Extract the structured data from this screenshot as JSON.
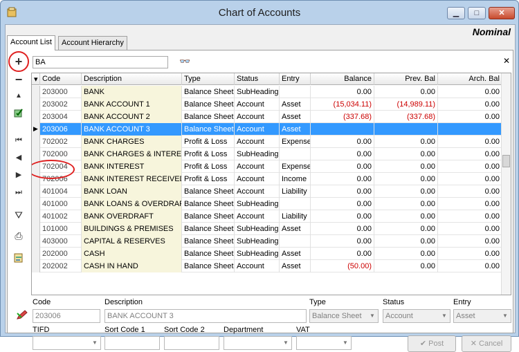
{
  "window": {
    "title": "Chart of Accounts",
    "module": "Nominal"
  },
  "tabs": [
    {
      "label": "Account List"
    },
    {
      "label": "Account Hierarchy"
    }
  ],
  "filter": {
    "value": "BA"
  },
  "columns": {
    "code": "Code",
    "description": "Description",
    "type": "Type",
    "status": "Status",
    "entry": "Entry",
    "balance": "Balance",
    "prev_bal": "Prev. Bal",
    "arch_bal": "Arch. Bal"
  },
  "rows": [
    {
      "code": "203000",
      "description": "BANK",
      "type": "Balance Sheet",
      "status": "SubHeading",
      "entry": "",
      "balance": "0.00",
      "prev_bal": "0.00",
      "arch_bal": "0.00"
    },
    {
      "code": "203002",
      "description": "BANK ACCOUNT 1",
      "type": "Balance Sheet",
      "status": "Account",
      "entry": "Asset",
      "balance": "(15,034.11)",
      "prev_bal": "(14,989.11)",
      "arch_bal": "0.00"
    },
    {
      "code": "203004",
      "description": "BANK ACCOUNT 2",
      "type": "Balance Sheet",
      "status": "Account",
      "entry": "Asset",
      "balance": "(337.68)",
      "prev_bal": "(337.68)",
      "arch_bal": "0.00"
    },
    {
      "code": "203006",
      "description": "BANK ACCOUNT 3",
      "type": "Balance Sheet",
      "status": "Account",
      "entry": "Asset",
      "balance": "",
      "prev_bal": "",
      "arch_bal": ""
    },
    {
      "code": "702002",
      "description": "BANK CHARGES",
      "type": "Profit & Loss",
      "status": "Account",
      "entry": "Expense",
      "balance": "0.00",
      "prev_bal": "0.00",
      "arch_bal": "0.00"
    },
    {
      "code": "702000",
      "description": "BANK CHARGES & INTEREST",
      "type": "Profit & Loss",
      "status": "SubHeading",
      "entry": "",
      "balance": "0.00",
      "prev_bal": "0.00",
      "arch_bal": "0.00"
    },
    {
      "code": "702004",
      "description": "BANK INTEREST",
      "type": "Profit & Loss",
      "status": "Account",
      "entry": "Expense",
      "balance": "0.00",
      "prev_bal": "0.00",
      "arch_bal": "0.00"
    },
    {
      "code": "702006",
      "description": "BANK INTEREST RECEIVED",
      "type": "Profit & Loss",
      "status": "Account",
      "entry": "Income",
      "balance": "0.00",
      "prev_bal": "0.00",
      "arch_bal": "0.00"
    },
    {
      "code": "401004",
      "description": "BANK LOAN",
      "type": "Balance Sheet",
      "status": "Account",
      "entry": "Liability",
      "balance": "0.00",
      "prev_bal": "0.00",
      "arch_bal": "0.00"
    },
    {
      "code": "401000",
      "description": "BANK LOANS & OVERDRAFT",
      "type": "Balance Sheet",
      "status": "SubHeading",
      "entry": "",
      "balance": "0.00",
      "prev_bal": "0.00",
      "arch_bal": "0.00"
    },
    {
      "code": "401002",
      "description": "BANK OVERDRAFT",
      "type": "Balance Sheet",
      "status": "Account",
      "entry": "Liability",
      "balance": "0.00",
      "prev_bal": "0.00",
      "arch_bal": "0.00"
    },
    {
      "code": "101000",
      "description": "BUILDINGS & PREMISES",
      "type": "Balance Sheet",
      "status": "SubHeading",
      "entry": "Asset",
      "balance": "0.00",
      "prev_bal": "0.00",
      "arch_bal": "0.00"
    },
    {
      "code": "403000",
      "description": "CAPITAL & RESERVES",
      "type": "Balance Sheet",
      "status": "SubHeading",
      "entry": "",
      "balance": "0.00",
      "prev_bal": "0.00",
      "arch_bal": "0.00"
    },
    {
      "code": "202000",
      "description": "CASH",
      "type": "Balance Sheet",
      "status": "SubHeading",
      "entry": "Asset",
      "balance": "0.00",
      "prev_bal": "0.00",
      "arch_bal": "0.00"
    },
    {
      "code": "202002",
      "description": "CASH IN HAND",
      "type": "Balance Sheet",
      "status": "Account",
      "entry": "Asset",
      "balance": "(50.00)",
      "prev_bal": "0.00",
      "arch_bal": "0.00"
    }
  ],
  "selected_row": 3,
  "detail": {
    "code_label": "Code",
    "code_value": "203006",
    "description_label": "Description",
    "description_value": "BANK ACCOUNT 3",
    "type_label": "Type",
    "type_value": "Balance Sheet",
    "status_label": "Status",
    "status_value": "Account",
    "entry_label": "Entry",
    "entry_value": "Asset",
    "tifd_label": "TIFD",
    "sort_code1_label": "Sort Code 1",
    "sort_code2_label": "Sort Code 2",
    "department_label": "Department",
    "vat_label": "VAT",
    "post_label": "Post",
    "cancel_label": "Cancel"
  },
  "colors": {
    "selection": "#3399ff",
    "negative": "#cc0000",
    "description_bg": "#f7f5dc",
    "annotation_ring": "#e02020"
  }
}
